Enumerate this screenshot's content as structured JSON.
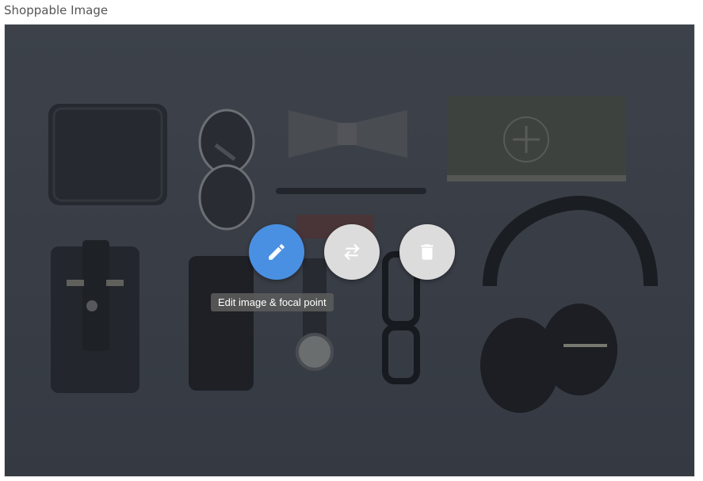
{
  "field": {
    "label": "Shoppable Image"
  },
  "image": {
    "alt": "Flat lay of wallet, sunglasses, bow tie, notebook, pen, watch, phone, glasses and headphones",
    "overlay_opacity": 0.28
  },
  "actions": {
    "edit": {
      "icon": "pencil-icon",
      "tooltip": "Edit image & focal point",
      "color": "#4a90e2"
    },
    "replace": {
      "icon": "swap-arrows-icon",
      "color": "#dcdcdc"
    },
    "remove": {
      "icon": "trash-icon",
      "color": "#dcdcdc"
    }
  }
}
